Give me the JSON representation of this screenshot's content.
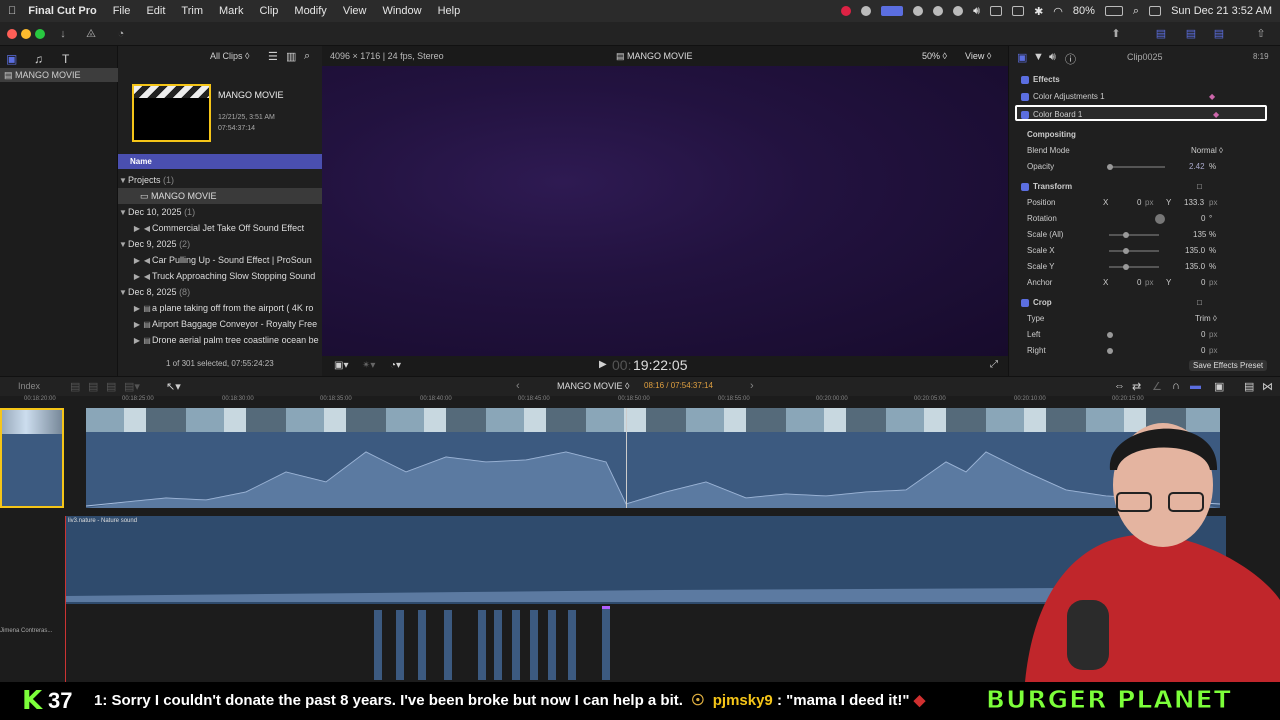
{
  "menubar": {
    "app_name": "Final Cut Pro",
    "menus": [
      "File",
      "Edit",
      "Trim",
      "Mark",
      "Clip",
      "Modify",
      "View",
      "Window",
      "Help"
    ],
    "battery": "80%",
    "datetime": "Sun Dec 21  3:52 AM"
  },
  "library": {
    "name": "MANGO MOVIE"
  },
  "browser": {
    "filter": "All Clips ◊",
    "project_thumb_title": "MANGO MOVIE",
    "project_date": "12/21/25, 3:51 AM",
    "project_duration": "07:54:37:14",
    "column_name": "Name",
    "groups": [
      {
        "label": "Projects",
        "count": "(1)"
      },
      {
        "label": "Dec 10, 2025",
        "count": "(1)"
      },
      {
        "label": "Dec 9, 2025",
        "count": "(2)"
      },
      {
        "label": "Dec 8, 2025",
        "count": "(8)"
      }
    ],
    "items": [
      "MANGO MOVIE",
      "Commercial Jet Take Off Sound Effect",
      "Car Pulling Up - Sound Effect | ProSoun",
      "Truck Approaching Slow Stopping Sound",
      "a plane taking off from the airport ( 4K ro",
      "Airport Baggage Conveyor - Royalty Free",
      "Drone aerial palm tree coastline ocean be"
    ],
    "selection_status": "1 of 301 selected, 07:55:24:23"
  },
  "viewer": {
    "format": "4096 × 1716 | 24 fps, Stereo",
    "title": "MANGO MOVIE",
    "zoom": "50% ◊",
    "view_label": "View ◊",
    "timecode_prefix": "00:",
    "timecode": "19:22:05"
  },
  "inspector": {
    "clip_name": "Clip0025",
    "clip_duration": "8:19",
    "section_effects": "Effects",
    "effect1": "Color Adjustments 1",
    "effect2": "Color Board 1",
    "section_compositing": "Compositing",
    "blend_mode_label": "Blend Mode",
    "blend_mode_value": "Normal ◊",
    "opacity_label": "Opacity",
    "opacity_value": "2.42",
    "opacity_unit": "%",
    "section_transform": "Transform",
    "position_label": "Position",
    "position_x_label": "X",
    "position_x": "0",
    "position_unit": "px",
    "position_y_label": "Y",
    "position_y": "133.3",
    "rotation_label": "Rotation",
    "rotation_value": "0",
    "rotation_unit": "°",
    "scale_all_label": "Scale (All)",
    "scale_all": "135",
    "scale_x_label": "Scale X",
    "scale_x": "135.0",
    "scale_y_label": "Scale Y",
    "scale_y": "135.0",
    "percent": "%",
    "anchor_label": "Anchor",
    "anchor_x": "0",
    "anchor_y": "0",
    "section_crop": "Crop",
    "type_label": "Type",
    "type_value": "Trim ◊",
    "left_label": "Left",
    "left_value": "0",
    "right_label": "Right",
    "right_value": "0",
    "save_preset": "Save Effects Preset"
  },
  "timeline": {
    "index_label": "Index",
    "project_name": "MANGO MOVIE ◊",
    "position": "08:16 / 07:54:37:14",
    "ruler": [
      "00:18:20:00",
      "00:18:25:00",
      "00:18:30:00",
      "00:18:35:00",
      "00:18:40:00",
      "00:18:45:00",
      "00:18:50:00",
      "00:18:55:00",
      "00:20:00:00",
      "00:20:05:00",
      "00:20:10:00",
      "00:20:15:00"
    ],
    "audio_clip_label": "liv3.nature - Nature sound",
    "side_label": "Jimena Contreras..."
  },
  "ticker": {
    "count": "37",
    "message1": "1: Sorry I couldn't donate the past 8 years. I've been broke but now I can help a bit.",
    "user2": "pjmsky9",
    "message2": ": \"mama I deed it!\"",
    "brand": "BURGER PLANET"
  },
  "colors": {
    "accent": "#5b6ee0",
    "video_purple": "#22123f",
    "waveform": "#3c5a80",
    "brand_green": "#7cff3a"
  }
}
